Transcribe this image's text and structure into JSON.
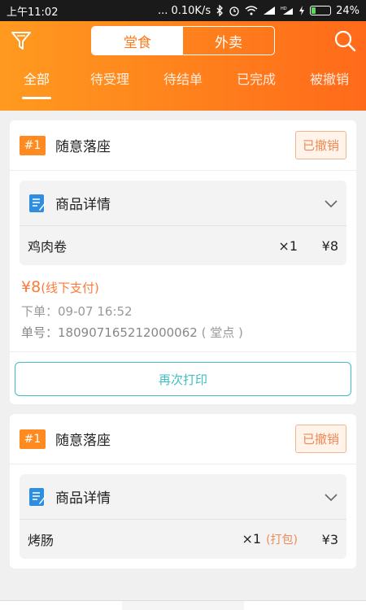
{
  "status": {
    "time": "上午11:02",
    "net": "... 0.10K/s",
    "battery": "24%",
    "battery_level": 0.24,
    "icons": [
      "bluetooth-icon",
      "alarm-icon",
      "wifi-icon",
      "signal-icon",
      "hd-signal-icon",
      "charging-icon"
    ]
  },
  "header": {
    "segments": [
      "堂食",
      "外卖"
    ],
    "active_segment": 0,
    "tabs": [
      "全部",
      "待受理",
      "待结单",
      "已完成",
      "被撤销"
    ],
    "active_tab": 0
  },
  "orders": [
    {
      "num": "#1",
      "title": "随意落座",
      "status": "已撤销",
      "detail_label": "商品详情",
      "items": [
        {
          "name": "鸡肉卷",
          "qty": "×1",
          "note": "",
          "price": "¥8"
        }
      ],
      "amount": "¥8",
      "pay_method": "(线下支付)",
      "order_time": "下单：09-07 16:52",
      "order_no_label": "单号：",
      "order_no": "180907165212000062",
      "order_type": "( 堂点 )",
      "print_label": "再次打印"
    },
    {
      "num": "#1",
      "title": "随意落座",
      "status": "已撤销",
      "detail_label": "商品详情",
      "items": [
        {
          "name": "烤肠",
          "qty": "×1",
          "note": "(打包)",
          "price": "¥3"
        }
      ]
    }
  ],
  "colors": {
    "accent": "#ff7a1a",
    "print": "#3fbfc4",
    "badge": "#ee8a55"
  }
}
